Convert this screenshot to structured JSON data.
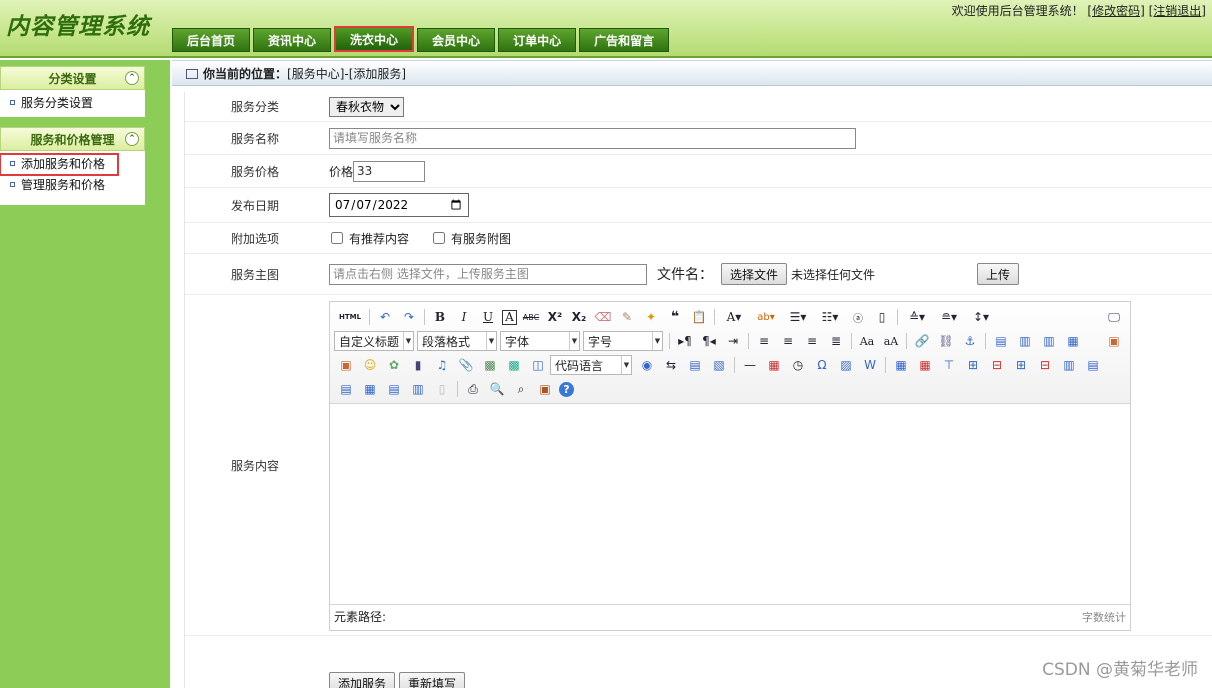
{
  "header": {
    "logo": "内容管理系统",
    "welcome": "欢迎使用后台管理系统！",
    "change_pwd": "[修改密码]",
    "logout": "[注销退出]",
    "tabs": [
      "后台首页",
      "资讯中心",
      "洗衣中心",
      "会员中心",
      "订单中心",
      "广告和留言"
    ],
    "active_tab": 2
  },
  "sidebar": {
    "groups": [
      {
        "title": "分类设置",
        "items": [
          "服务分类设置"
        ]
      },
      {
        "title": "服务和价格管理",
        "items": [
          "添加服务和价格",
          "管理服务和价格"
        ]
      }
    ]
  },
  "breadcrumb": {
    "label": "你当前的位置：",
    "path": "[服务中心]-[添加服务]"
  },
  "form": {
    "category_label": "服务分类",
    "category_value": "春秋衣物",
    "name_label": "服务名称",
    "name_placeholder": "请填写服务名称",
    "price_label": "服务价格",
    "price_prefix": "价格",
    "price_value": "33",
    "date_label": "发布日期",
    "date_value": "2022-07-07",
    "options_label": "附加选项",
    "opt_recommend": "有推荐内容",
    "opt_image": "有服务附图",
    "image_label": "服务主图",
    "image_placeholder": "请点击右侧 选择文件，上传服务主图",
    "file_label": "文件名：",
    "choose_file": "选择文件",
    "no_file": "未选择任何文件",
    "upload": "上传",
    "content_label": "服务内容",
    "submit": "添加服务",
    "reset": "重新填写"
  },
  "editor": {
    "combos": {
      "heading": "自定义标题",
      "paragraph": "段落格式",
      "font": "字体",
      "size": "字号",
      "code": "代码语言"
    },
    "path_label": "元素路径:",
    "word_count": "字数统计"
  },
  "watermark": "CSDN @黄菊华老师"
}
